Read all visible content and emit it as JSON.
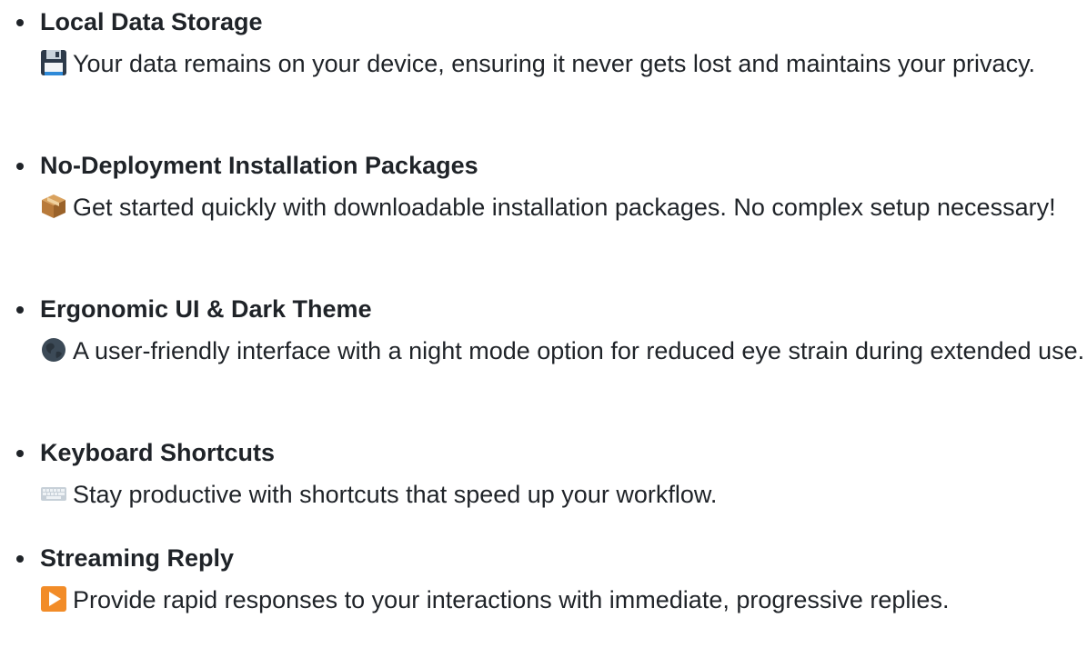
{
  "features": [
    {
      "title": "Local Data Storage",
      "icon": "floppy-disk-icon",
      "description": "Your data remains on your device, ensuring it never gets lost and maintains your privacy."
    },
    {
      "title": "No-Deployment Installation Packages",
      "icon": "package-icon",
      "description": "Get started quickly with downloadable installation packages. No complex setup necessary!"
    },
    {
      "title": "Ergonomic UI & Dark Theme",
      "icon": "dark-globe-icon",
      "description": "A user-friendly interface with a night mode option for reduced eye strain during extended use."
    },
    {
      "title": "Keyboard Shortcuts",
      "icon": "keyboard-icon",
      "description": "Stay productive with shortcuts that speed up your workflow."
    },
    {
      "title": "Streaming Reply",
      "icon": "play-button-icon",
      "description": "Provide rapid responses to your interactions with immediate, progressive replies."
    }
  ]
}
